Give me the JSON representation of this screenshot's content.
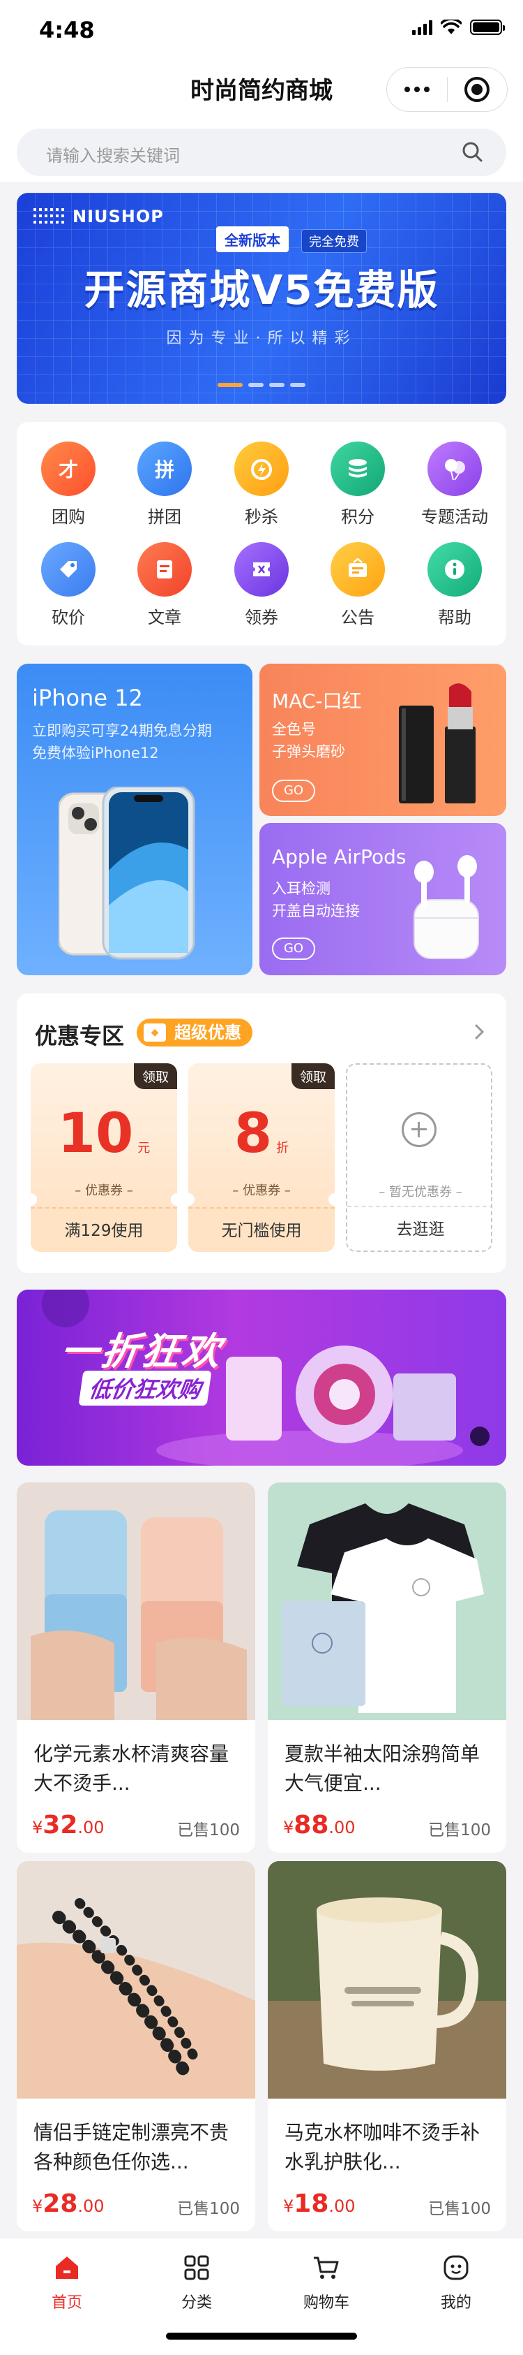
{
  "status_bar": {
    "time": "4:48"
  },
  "nav": {
    "title": "时尚简约商城",
    "more_icon": "more-dots-icon",
    "close_icon": "target-icon"
  },
  "search": {
    "placeholder": "请输入搜索关键词",
    "icon": "search-icon"
  },
  "banner": {
    "brand": "NIUSHOP",
    "tag_new": "全新版本",
    "tag_free": "完全免费",
    "headline": "开源商城V5免费版",
    "subtitle": "因为专业·所以精彩",
    "slides": 4,
    "active_slide": 1,
    "accent": "#1b3fd8"
  },
  "menu": {
    "items": [
      {
        "label": "团购",
        "icon": "group-buy-icon",
        "color": "#ff6a3d"
      },
      {
        "label": "拼团",
        "icon": "pin-group-icon",
        "color": "#3d8ef5"
      },
      {
        "label": "秒杀",
        "icon": "flash-sale-icon",
        "color": "#ffb21f"
      },
      {
        "label": "积分",
        "icon": "points-icon",
        "color": "#21c08b"
      },
      {
        "label": "专题活动",
        "icon": "topic-balloon-icon",
        "color": "#a155f0"
      },
      {
        "label": "砍价",
        "icon": "bargain-tag-icon",
        "color": "#4a8ff5"
      },
      {
        "label": "文章",
        "icon": "article-icon",
        "color": "#ff5b3a"
      },
      {
        "label": "领券",
        "icon": "coupon-icon",
        "color": "#8a4df0"
      },
      {
        "label": "公告",
        "icon": "notice-icon",
        "color": "#ffb21f"
      },
      {
        "label": "帮助",
        "icon": "help-icon",
        "color": "#21c08b"
      }
    ]
  },
  "promos": {
    "left": {
      "title": "iPhone 12",
      "desc_line1": "立即购买可享24期免息分期",
      "desc_line2": "免费体验iPhone12"
    },
    "right_top": {
      "title": "MAC-口红",
      "desc_line1": "全色号",
      "desc_line2": "子弹头磨砂",
      "cta": "GO"
    },
    "right_bottom": {
      "title": "Apple AirPods",
      "desc_line1": "入耳检测",
      "desc_line2": "开盖自动连接",
      "cta": "GO"
    }
  },
  "coupons": {
    "title": "优惠专区",
    "badge": "超级优惠",
    "items": [
      {
        "claim": "领取",
        "amount": "10",
        "unit": "元",
        "label": "– 优惠券 –",
        "condition": "满129使用"
      },
      {
        "claim": "领取",
        "amount": "8",
        "unit": "折",
        "label": "– 优惠券 –",
        "condition": "无门槛使用"
      }
    ],
    "empty": {
      "label": "– 暂无优惠券 –",
      "action": "去逛逛"
    }
  },
  "sale_banner": {
    "headline": "一折狂欢",
    "sub": "低价狂欢购"
  },
  "products": [
    {
      "name_line1": "化学元素水杯清爽容量",
      "name_line2": "大不烫手...",
      "currency": "¥",
      "price_int": "32",
      "price_dec": ".00",
      "sold": "已售100"
    },
    {
      "name_line1": "夏款半袖太阳涂鸦简单",
      "name_line2": "大气便宜...",
      "currency": "¥",
      "price_int": "88",
      "price_dec": ".00",
      "sold": "已售100"
    },
    {
      "name_line1": "情侣手链定制漂亮不贵",
      "name_line2": "各种颜色任你选...",
      "currency": "¥",
      "price_int": "28",
      "price_dec": ".00",
      "sold": "已售100"
    },
    {
      "name_line1": "马克水杯咖啡不烫手补",
      "name_line2": "水乳护肤化...",
      "currency": "¥",
      "price_int": "18",
      "price_dec": ".00",
      "sold": "已售100"
    }
  ],
  "tabbar": {
    "items": [
      {
        "label": "首页",
        "icon": "home-icon",
        "active": true
      },
      {
        "label": "分类",
        "icon": "category-grid-icon",
        "active": false
      },
      {
        "label": "购物车",
        "icon": "cart-icon",
        "active": false
      },
      {
        "label": "我的",
        "icon": "profile-icon",
        "active": false
      }
    ],
    "accent": "#e92b24"
  }
}
